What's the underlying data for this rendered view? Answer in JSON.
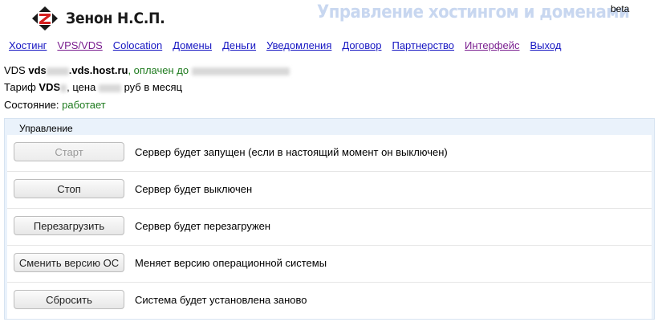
{
  "header": {
    "logo_name": "Зенон Н.С.П.",
    "slogan": "Управление хостингом и доменами",
    "beta_label": "beta"
  },
  "nav": [
    {
      "label": "Хостинг",
      "state": "link"
    },
    {
      "label": "VPS/VDS",
      "state": "visited"
    },
    {
      "label": "Colocation",
      "state": "link"
    },
    {
      "label": "Домены",
      "state": "link"
    },
    {
      "label": "Деньги",
      "state": "link"
    },
    {
      "label": "Уведомления",
      "state": "link"
    },
    {
      "label": "Договор",
      "state": "link"
    },
    {
      "label": "Партнерство",
      "state": "link"
    },
    {
      "label": "Интерфейс",
      "state": "visited"
    },
    {
      "label": "Выход",
      "state": "link"
    }
  ],
  "server": {
    "prefix": "VDS",
    "host_start": "vds",
    "host_end": ".vds.host.ru",
    "paid_label": ", оплачен до",
    "tariff_label": "Тариф",
    "tariff_name": "VDS",
    "price_label": ", цена",
    "price_unit": "руб в месяц",
    "state_label": "Состояние:",
    "state_value": "работает"
  },
  "panel": {
    "title": "Управление",
    "actions": [
      {
        "button": "Старт",
        "description": "Сервер будет запущен (если в настоящий момент он выключен)",
        "disabled": true
      },
      {
        "button": "Стоп",
        "description": "Сервер будет выключен",
        "disabled": false
      },
      {
        "button": "Перезагрузить",
        "description": "Сервер будет перезагружен",
        "disabled": false
      },
      {
        "button": "Сменить версию ОС",
        "description": "Меняет версию операционной системы",
        "disabled": false
      },
      {
        "button": "Сбросить",
        "description": "Система будет установлена заново",
        "disabled": false
      }
    ]
  },
  "colors": {
    "link": "#1515c2",
    "visited": "#7a1f8f",
    "status_green": "#1d7a1d",
    "slogan": "#c8d7f0",
    "panel_bg": "#eaf2fb"
  }
}
